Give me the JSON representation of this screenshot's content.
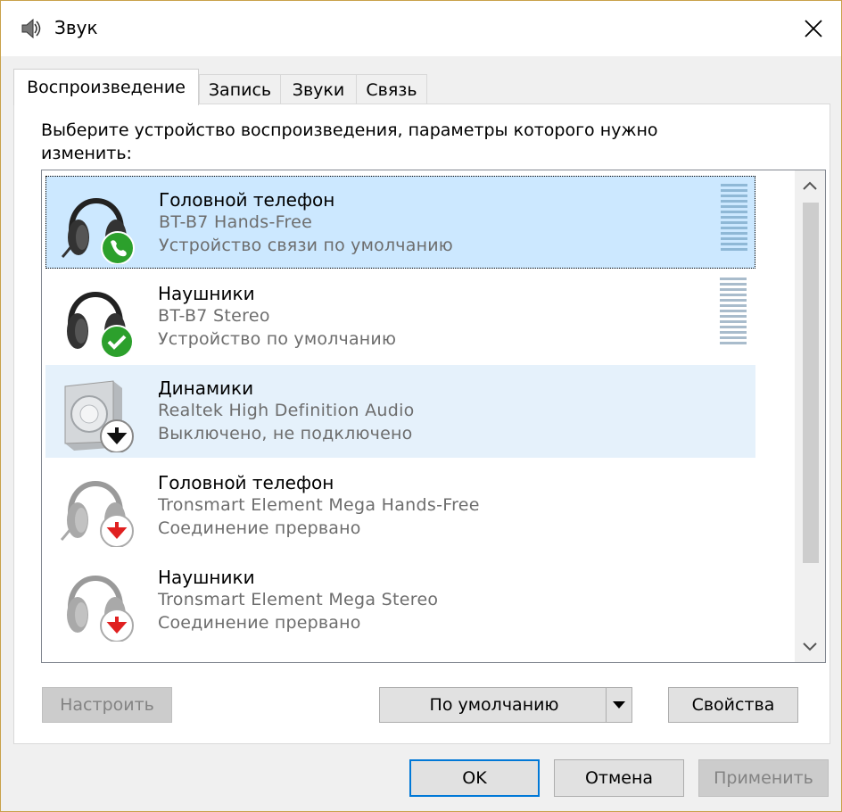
{
  "window": {
    "title": "Звук"
  },
  "tabs": [
    {
      "label": "Воспроизведение",
      "active": true
    },
    {
      "label": "Запись",
      "active": false
    },
    {
      "label": "Звуки",
      "active": false
    },
    {
      "label": "Связь",
      "active": false
    }
  ],
  "instruction": "Выберите устройство воспроизведения, параметры которого нужно изменить:",
  "devices": [
    {
      "name": "Головной телефон",
      "description": "BT-B7 Hands-Free",
      "status": "Устройство связи по умолчанию",
      "icon": "headset-icon",
      "badge": "phone-badge-icon",
      "state": "selected"
    },
    {
      "name": "Наушники",
      "description": "BT-B7 Stereo",
      "status": "Устройство по умолчанию",
      "icon": "headphones-icon",
      "badge": "check-badge-icon",
      "state": "normal"
    },
    {
      "name": "Динамики",
      "description": "Realtek High Definition Audio",
      "status": "Выключено, не подключено",
      "icon": "speaker-icon",
      "badge": "down-arrow-badge-icon",
      "state": "hovered"
    },
    {
      "name": "Головной телефон",
      "description": "Tronsmart Element Mega Hands-Free",
      "status": "Соединение прервано",
      "icon": "headset-icon",
      "badge": "red-down-arrow-badge-icon",
      "state": "normal"
    },
    {
      "name": "Наушники",
      "description": "Tronsmart Element Mega Stereo",
      "status": "Соединение прервано",
      "icon": "headphones-icon",
      "badge": "red-down-arrow-badge-icon",
      "state": "normal"
    }
  ],
  "buttons": {
    "configure": "Настроить",
    "set_default": "По умолчанию",
    "properties": "Свойства",
    "ok": "OK",
    "cancel": "Отмена",
    "apply": "Применить"
  },
  "colors": {
    "selection": "#cce8ff",
    "hover": "#e5f1fb",
    "focus_border": "#0078d7",
    "green_badge": "#2ca02c",
    "red_badge": "#e02020"
  }
}
